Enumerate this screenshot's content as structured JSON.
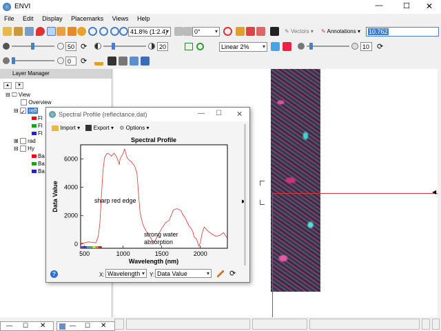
{
  "app": {
    "title": "ENVI"
  },
  "menu": [
    "File",
    "Edit",
    "Display",
    "Placemarks",
    "Views",
    "Help"
  ],
  "toolbar1": {
    "zoom": "41.8% (1:2.4)",
    "rotation": "0°",
    "vectors": "Vectors",
    "annotations": "Annotations",
    "search_value": "10.762"
  },
  "toolbar2": {
    "brightness": "50",
    "contrast": "20",
    "stretch": "Linear 2%",
    "sharpen": "10"
  },
  "toolbar3": {
    "transparency": "0"
  },
  "layer_manager": {
    "title": "Layer Manager",
    "tree": {
      "view": "View",
      "overview": "Overview",
      "refl": "refl",
      "band_fl": "Fl",
      "rad": "rad",
      "hy": "Hy",
      "band_b": "Ba"
    }
  },
  "spectral_window": {
    "title": "Spectral Profile (reflectance.dat)",
    "import": "Import",
    "export": "Export",
    "options": "Options",
    "x_axis_select": "Wavelength",
    "y_axis_select": "Data Value",
    "x_prefix": "X:",
    "y_prefix": "Y:"
  },
  "chart_data": {
    "type": "line",
    "title": "Spectral Profile",
    "xlabel": "Wavelength (nm)",
    "ylabel": "Data Value",
    "xlim": [
      450,
      2350
    ],
    "ylim": [
      -300,
      7000
    ],
    "xticks": [
      500,
      1000,
      1500,
      2000
    ],
    "yticks": [
      0,
      2000,
      4000,
      6000
    ],
    "annotations": [
      "sharp red edge",
      "strong water absorption"
    ],
    "series": [
      {
        "color": "#e0302a",
        "x": [
          450,
          500,
          550,
          600,
          650,
          680,
          700,
          720,
          740,
          760,
          780,
          800,
          820,
          850,
          880,
          900,
          920,
          940,
          950,
          960,
          980,
          1000,
          1020,
          1050,
          1080,
          1100,
          1120,
          1150,
          1180,
          1200,
          1220,
          1250,
          1270,
          1300,
          1320,
          1340,
          1360,
          1380,
          1400,
          1420,
          1450,
          1480,
          1500,
          1550,
          1600,
          1650,
          1700,
          1750,
          1780,
          1800,
          1850,
          1880,
          1900,
          1920,
          1950,
          1980,
          2000,
          2020,
          2050,
          2100,
          2150,
          2200,
          2250,
          2300,
          2350
        ],
        "y": [
          50,
          80,
          150,
          120,
          80,
          600,
          1500,
          3500,
          5200,
          6100,
          6300,
          6400,
          6350,
          6200,
          6400,
          6300,
          6100,
          5800,
          5600,
          6000,
          6200,
          6400,
          6700,
          6100,
          5900,
          5850,
          5700,
          5500,
          5000,
          3500,
          2200,
          1500,
          1200,
          900,
          700,
          600,
          400,
          200,
          150,
          300,
          600,
          900,
          1100,
          1500,
          1700,
          2400,
          2500,
          2350,
          2000,
          1900,
          1300,
          1100,
          900,
          500,
          350,
          -150,
          100,
          700,
          1200,
          900,
          700,
          550,
          600,
          800,
          400
        ]
      }
    ]
  },
  "status_bar": {
    "cells": [
      "",
      "",
      "",
      "",
      "",
      ""
    ]
  }
}
